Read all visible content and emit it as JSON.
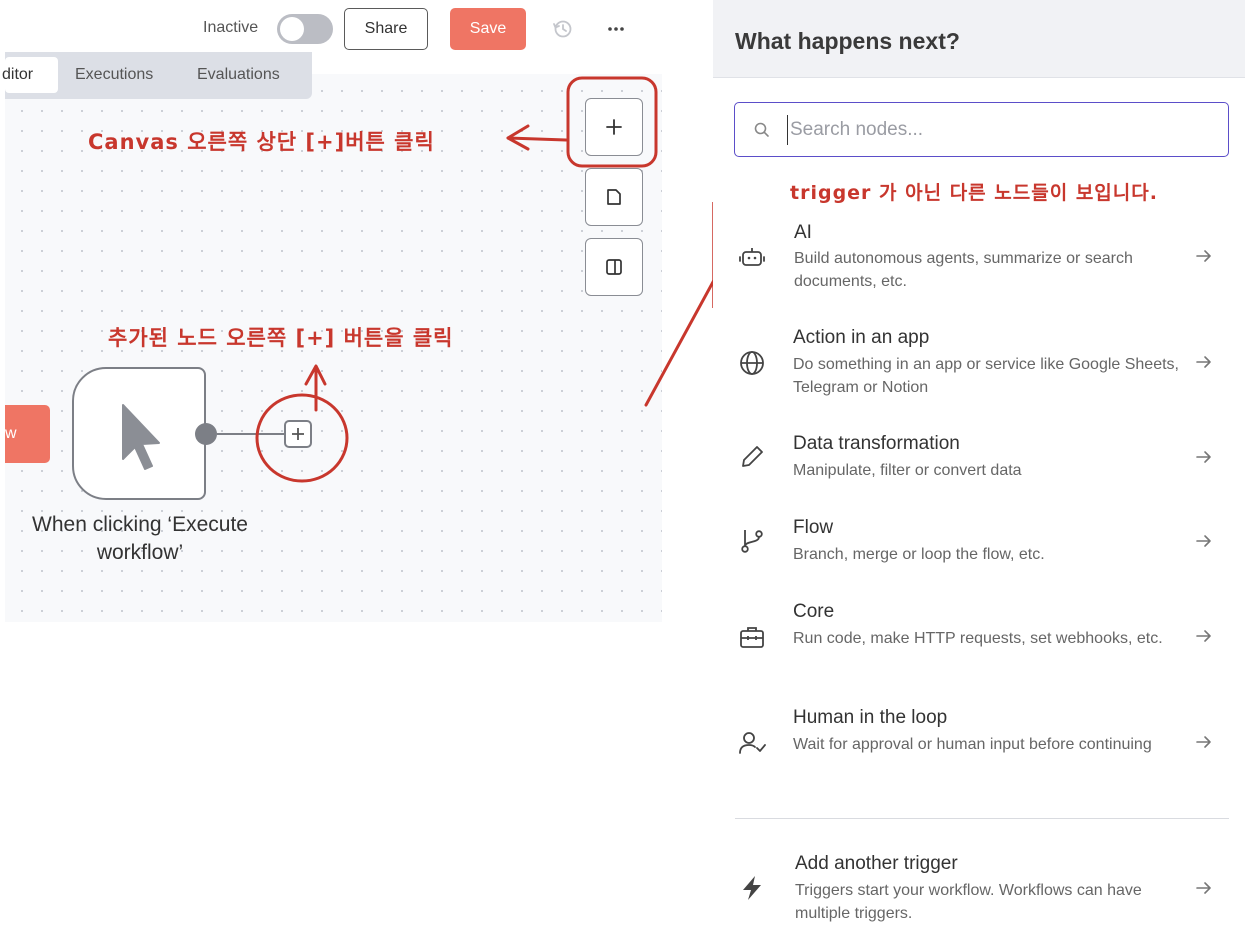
{
  "toolbar": {
    "status_label": "Inactive",
    "share_label": "Share",
    "save_label": "Save",
    "more_label": "···"
  },
  "tabs": [
    {
      "label": "ditor",
      "active": true
    },
    {
      "label": "Executions",
      "active": false
    },
    {
      "label": "Evaluations",
      "active": false
    }
  ],
  "canvas": {
    "left_node_label": "w",
    "trigger_node_caption": "When clicking ‘Execute workflow’"
  },
  "annotations": {
    "canvas_plus": "Canvas 오른쪽 상단 [+]버튼 클릭",
    "node_plus": "추가된 노드 오른쪽 [+] 버튼을 클릭",
    "panel_note": "trigger 가 아닌 다른 노드들이 보입니다."
  },
  "panel": {
    "title": "What happens next?",
    "search_placeholder": "Search nodes...",
    "items": [
      {
        "icon": "robot-icon",
        "title": "AI",
        "description": "Build autonomous agents, summarize or search documents, etc."
      },
      {
        "icon": "globe-icon",
        "title": "Action in an app",
        "description": "Do something in an app or service like Google Sheets, Telegram or Notion"
      },
      {
        "icon": "pencil-icon",
        "title": "Data transformation",
        "description": "Manipulate, filter or convert data"
      },
      {
        "icon": "branch-icon",
        "title": "Flow",
        "description": "Branch, merge or loop the flow, etc."
      },
      {
        "icon": "toolbox-icon",
        "title": "Core",
        "description": "Run code, make HTTP requests, set webhooks, etc."
      },
      {
        "icon": "user-check-icon",
        "title": "Human in the loop",
        "description": "Wait for approval or human input before continuing"
      }
    ],
    "trigger_item": {
      "icon": "bolt-icon",
      "title": "Add another trigger",
      "description": "Triggers start your workflow. Workflows can have multiple triggers."
    }
  },
  "colors": {
    "accent": "#ef7564",
    "annotation_red": "#c8372d",
    "search_border": "#5b4ec9"
  }
}
